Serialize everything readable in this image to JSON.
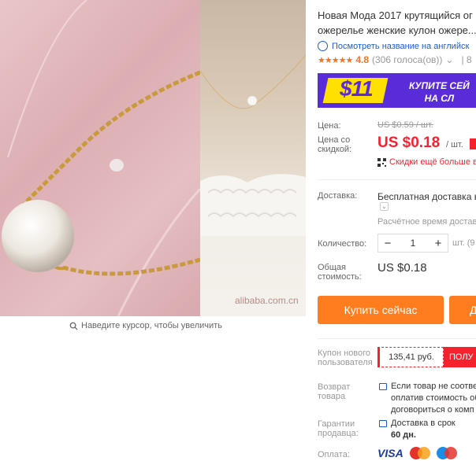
{
  "product": {
    "title_line1": "Новая Мода 2017 крутящийся ог",
    "title_line2": "ожерелье женские кулон ожере..."
  },
  "translate_link": "Посмотреть название на английск",
  "rating": {
    "stars": "★★★★★",
    "value": "4.8",
    "count": "(306 голоса(ов))",
    "caret": "⌄",
    "sep": "| 8"
  },
  "banner": {
    "amount": "$11",
    "text_line1": "КУПИТЕ СЕЙ",
    "text_line2": "НА СЛ"
  },
  "price": {
    "label": "Цена:",
    "old": "US $0.59 / шт.",
    "discount_label_line1": "Цена со",
    "discount_label_line2": "скидкой:",
    "new": "US $0.18",
    "unit": "/ шт."
  },
  "more_discounts": "Скидки ещё больше в",
  "shipping": {
    "label": "Доставка:",
    "value": "Бесплатная доставка в",
    "caret": "⌄",
    "time_text": "Расчётное время доставк"
  },
  "quantity": {
    "label": "Количество:",
    "minus": "−",
    "value": "1",
    "plus": "+",
    "unit": "шт. (9"
  },
  "total": {
    "label_line1": "Общая",
    "label_line2": "стоимость:",
    "value": "US $0.18"
  },
  "buttons": {
    "buy_now": "Купить сейчас",
    "add_to_cart": "Д"
  },
  "coupon": {
    "label_line1": "Купон нового",
    "label_line2": "пользователя",
    "amount": "135,41 руб.",
    "get": "ПОЛУ"
  },
  "return": {
    "label_line1": "Возврат",
    "label_line2": "товара",
    "line1": "Если товар не соответ",
    "line2": "оплатив стоимость об",
    "line3": "договориться о комп"
  },
  "guarantee": {
    "label_line1": "Гарантии",
    "label_line2": "продавца:",
    "line1": "Доставка в срок",
    "line2": "60 дн."
  },
  "payment": {
    "label": "Оплата:",
    "visa": "VISA"
  },
  "gallery": {
    "watermark": "alibaba.com.cn",
    "zoom_hint": "Наведите курсор, чтобы увеличить"
  },
  "colors": {
    "accent_orange": "#ff7c1f",
    "price_red": "#f5222d",
    "link_blue": "#1a5cd0",
    "banner_purple": "#5a2bd9",
    "banner_yellow": "#ffe000"
  }
}
